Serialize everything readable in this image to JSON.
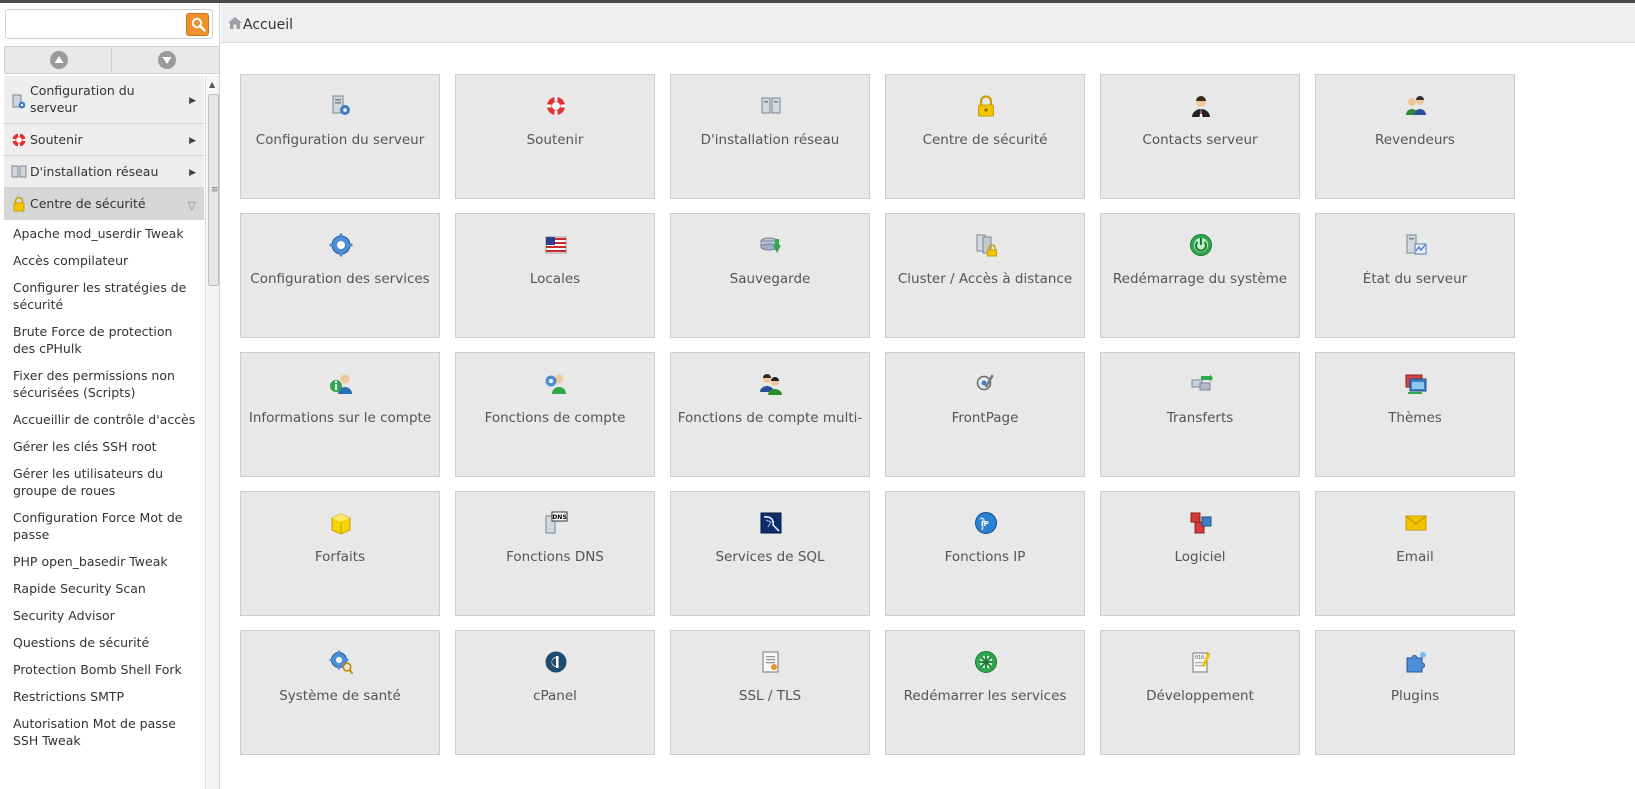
{
  "search": {
    "value": "",
    "placeholder": ""
  },
  "sidebar": {
    "categories": [
      {
        "label": "Configuration du serveur",
        "icon": "server-gear-icon",
        "expanded": false
      },
      {
        "label": "Soutenir",
        "icon": "lifebuoy-icon",
        "expanded": false
      },
      {
        "label": "D'installation réseau",
        "icon": "network-icon",
        "expanded": false
      },
      {
        "label": "Centre de sécurité",
        "icon": "lock-icon",
        "expanded": true
      }
    ],
    "security_items": [
      "Apache mod_userdir Tweak",
      "Accès compilateur",
      "Configurer les stratégies de sécurité",
      "Brute Force de protection des cPHulk",
      "Fixer des permissions non sécurisées (Scripts)",
      "Accueillir de contrôle d'accès",
      "Gérer les clés SSH root",
      "Gérer les utilisateurs du groupe de roues",
      "Configuration Force Mot de passe",
      "PHP open_basedir Tweak",
      "Rapide Security Scan",
      "Security Advisor",
      "Questions de sécurité",
      "Protection Bomb Shell Fork",
      "Restrictions SMTP",
      "Autorisation Mot de passe SSH Tweak"
    ]
  },
  "breadcrumb": {
    "home_label": "Accueil"
  },
  "tiles": [
    {
      "label": "Configuration du serveur",
      "icon": "server-gear-icon"
    },
    {
      "label": "Soutenir",
      "icon": "lifebuoy-icon"
    },
    {
      "label": "D'installation réseau",
      "icon": "network-icon"
    },
    {
      "label": "Centre de sécurité",
      "icon": "lock-icon"
    },
    {
      "label": "Contacts serveur",
      "icon": "contact-person-icon"
    },
    {
      "label": "Revendeurs",
      "icon": "resellers-icon"
    },
    {
      "label": "Configuration des services",
      "icon": "gear-icon"
    },
    {
      "label": "Locales",
      "icon": "flag-icon"
    },
    {
      "label": "Sauvegarde",
      "icon": "backup-icon"
    },
    {
      "label": "Cluster / Accès à distance",
      "icon": "cluster-lock-icon"
    },
    {
      "label": "Redémarrage du système",
      "icon": "power-icon"
    },
    {
      "label": "État du serveur",
      "icon": "server-status-icon"
    },
    {
      "label": "Informations sur le compte",
      "icon": "account-info-icon"
    },
    {
      "label": "Fonctions de compte",
      "icon": "account-gear-icon"
    },
    {
      "label": "Fonctions de compte multi-",
      "icon": "multi-account-icon"
    },
    {
      "label": "FrontPage",
      "icon": "frontpage-icon"
    },
    {
      "label": "Transferts",
      "icon": "transfer-icon"
    },
    {
      "label": "Thèmes",
      "icon": "themes-icon"
    },
    {
      "label": "Forfaits",
      "icon": "package-icon"
    },
    {
      "label": "Fonctions DNS",
      "icon": "dns-icon"
    },
    {
      "label": "Services de SQL",
      "icon": "sql-icon"
    },
    {
      "label": "Fonctions IP",
      "icon": "ip-globe-icon"
    },
    {
      "label": "Logiciel",
      "icon": "software-cubes-icon"
    },
    {
      "label": "Email",
      "icon": "envelope-icon"
    },
    {
      "label": "Système de santé",
      "icon": "health-gear-icon"
    },
    {
      "label": "cPanel",
      "icon": "cpanel-logo-icon"
    },
    {
      "label": "SSL / TLS",
      "icon": "certificate-icon"
    },
    {
      "label": "Redémarrer les services",
      "icon": "restart-services-icon"
    },
    {
      "label": "Développement",
      "icon": "development-icon"
    },
    {
      "label": "Plugins",
      "icon": "puzzle-icon"
    }
  ],
  "colors": {
    "search_button": "#f0902a",
    "tile_background": "#e8e8e8",
    "sidebar_category": "#eeeeee"
  }
}
